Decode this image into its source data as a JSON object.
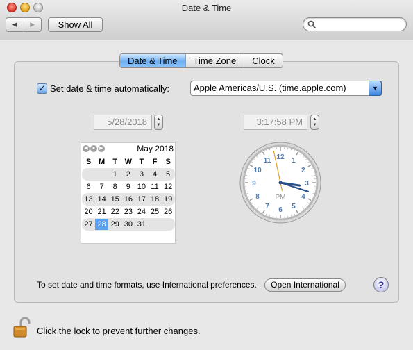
{
  "window": {
    "title": "Date & Time"
  },
  "toolbar": {
    "back": "◀",
    "forward": "▶",
    "show_all": "Show All",
    "search_placeholder": ""
  },
  "tabs": [
    {
      "label": "Date & Time",
      "active": true
    },
    {
      "label": "Time Zone",
      "active": false
    },
    {
      "label": "Clock",
      "active": false
    }
  ],
  "auto": {
    "checked": true,
    "check_mark": "✓",
    "label": "Set date & time automatically:",
    "server": "Apple Americas/U.S. (time.apple.com)"
  },
  "date_field": "5/28/2018",
  "time_field": "3:17:58  PM",
  "stepper": {
    "up": "▲",
    "down": "▼"
  },
  "calendar": {
    "nav": [
      "◀",
      "●",
      "▶"
    ],
    "month": "May 2018",
    "weekdays": [
      "S",
      "M",
      "T",
      "W",
      "T",
      "F",
      "S"
    ],
    "weeks": [
      [
        "",
        "",
        "1",
        "2",
        "3",
        "4",
        "5"
      ],
      [
        "6",
        "7",
        "8",
        "9",
        "10",
        "11",
        "12"
      ],
      [
        "13",
        "14",
        "15",
        "16",
        "17",
        "18",
        "19"
      ],
      [
        "20",
        "21",
        "22",
        "23",
        "24",
        "25",
        "26"
      ],
      [
        "27",
        "28",
        "29",
        "30",
        "31",
        "",
        ""
      ]
    ],
    "selected_day": "28"
  },
  "clock": {
    "numerals": [
      "12",
      "1",
      "2",
      "3",
      "4",
      "5",
      "6",
      "7",
      "8",
      "9",
      "10",
      "11"
    ],
    "ampm": "PM",
    "hour": 3,
    "minute": 17,
    "second": 58
  },
  "footer": {
    "formats_text": "To set date and time formats, use International preferences.",
    "open_international": "Open International",
    "help": "?",
    "lock_text": "Click the lock to prevent further changes."
  },
  "colors": {
    "accent": "#5aa0ee",
    "clock_numerals": "#4d7bb0",
    "second_hand": "#e0a020"
  }
}
